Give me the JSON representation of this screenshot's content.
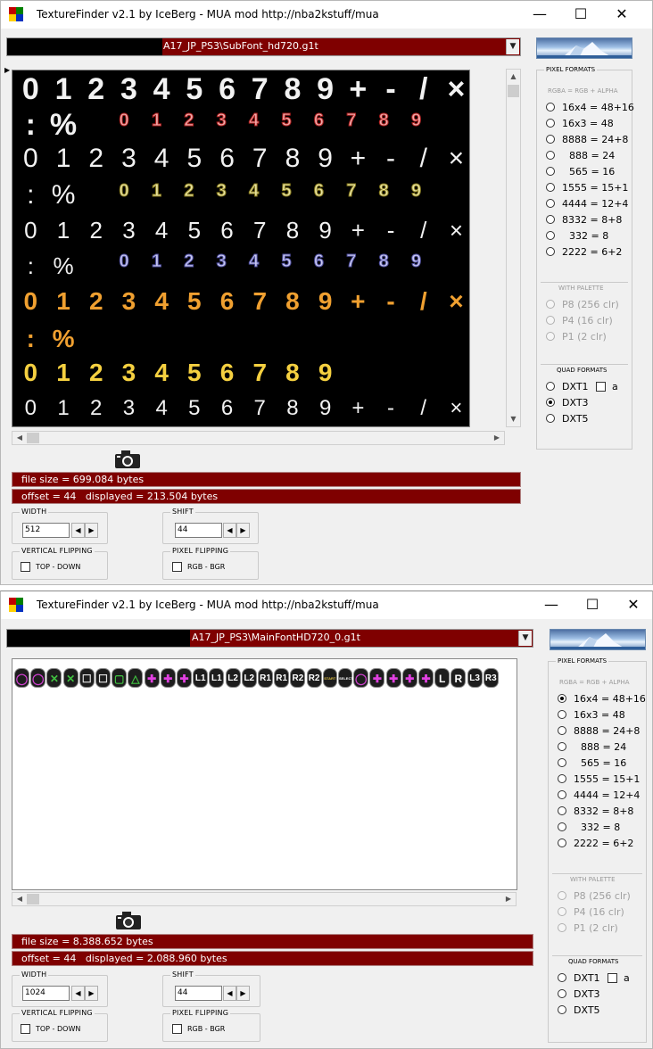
{
  "windows": [
    {
      "title": "TextureFinder v2.1 by IceBerg - MUA mod http://nba2kstuff/mua",
      "controls": {
        "minimize": "—",
        "maximize": "☐",
        "close": "✕"
      },
      "path": "A17_JP_PS3\\SubFont_hd720.g1t",
      "file_size": "file size = 699.084 bytes",
      "offset_info": "offset = 44   displayed = 213.504 bytes",
      "width_label": "WIDTH",
      "width_value": "512",
      "shift_label": "SHIFT",
      "shift_value": "44",
      "vflip_label": "VERTICAL FLIPPING",
      "vflip_option": "TOP - DOWN",
      "pflip_label": "PIXEL FLIPPING",
      "pflip_option": "RGB  -  BGR",
      "pixel_formats_label": "PIXEL FORMATS",
      "rgba_label": "RGBA = RGB + ALPHA",
      "formats": [
        "16x4 = 48+16",
        "16x3 = 48",
        "8888 = 24+8",
        "888 = 24",
        "565 = 16",
        "1555 = 15+1",
        "4444 = 12+4",
        "8332 = 8+8",
        "332 = 8",
        "2222 = 6+2"
      ],
      "selected_format": -1,
      "palette_label": "WITH PALETTE",
      "palette": [
        "P8  (256 clr)",
        "P4  (16 clr)",
        "P1  (2 clr)"
      ],
      "quad_label": "QUAD FORMATS",
      "quad": [
        "DXT1",
        "DXT3",
        "DXT5"
      ],
      "quad_a_label": "a",
      "selected_quad": 1
    },
    {
      "title": "TextureFinder v2.1 by IceBerg - MUA mod http://nba2kstuff/mua",
      "controls": {
        "minimize": "—",
        "maximize": "☐",
        "close": "✕"
      },
      "path": "A17_JP_PS3\\MainFontHD720_0.g1t",
      "file_size": "file size = 8.388.652 bytes",
      "offset_info": "offset = 44   displayed = 2.088.960 bytes",
      "width_label": "WIDTH",
      "width_value": "1024",
      "shift_label": "SHIFT",
      "shift_value": "44",
      "vflip_label": "VERTICAL FLIPPING",
      "vflip_option": "TOP - DOWN",
      "pflip_label": "PIXEL FLIPPING",
      "pflip_option": "RGB  -  BGR",
      "pixel_formats_label": "PIXEL FORMATS",
      "rgba_label": "RGBA = RGB + ALPHA",
      "formats": [
        "16x4 = 48+16",
        "16x3 = 48",
        "8888 = 24+8",
        "888 = 24",
        "565 = 16",
        "1555 = 15+1",
        "4444 = 12+4",
        "8332 = 8+8",
        "332 = 8",
        "2222 = 6+2"
      ],
      "selected_format": 0,
      "palette_label": "WITH PALETTE",
      "palette": [
        "P8  (256 clr)",
        "P4  (16 clr)",
        "P1  (2 clr)"
      ],
      "quad_label": "QUAD FORMATS",
      "quad": [
        "DXT1",
        "DXT3",
        "DXT5"
      ],
      "quad_a_label": "a",
      "selected_quad": -1
    }
  ],
  "texture1": {
    "rows": [
      {
        "glyphs": [
          "0",
          "1",
          "2",
          "3",
          "4",
          "5",
          "6",
          "7",
          "8",
          "9",
          "+",
          "-",
          "/",
          "×"
        ],
        "color": "#f2f2f2",
        "size": 34,
        "bold": true
      },
      {
        "glyphs": [
          ":",
          "%"
        ],
        "color": "#f2f2f2",
        "size": 34,
        "bold": true,
        "small": [
          "0",
          "1",
          "2",
          "3",
          "4",
          "5",
          "6",
          "7",
          "8",
          "9"
        ],
        "small_color": "#f0a8a8",
        "small_stroke": "#b02020"
      },
      {
        "glyphs": [
          "0",
          "1",
          "2",
          "3",
          "4",
          "5",
          "6",
          "7",
          "8",
          "9",
          "+",
          "-",
          "/",
          "×"
        ],
        "color": "#f2f2f2",
        "size": 30,
        "bold": false
      },
      {
        "glyphs": [
          ":",
          "%"
        ],
        "color": "#f2f2f2",
        "size": 30,
        "bold": false,
        "small": [
          "0",
          "1",
          "2",
          "3",
          "4",
          "5",
          "6",
          "7",
          "8",
          "9"
        ],
        "small_color": "#e8e2a0",
        "small_stroke": "#8a7d20"
      },
      {
        "glyphs": [
          "0",
          "1",
          "2",
          "3",
          "4",
          "5",
          "6",
          "7",
          "8",
          "9",
          "+",
          "-",
          "/",
          "×"
        ],
        "color": "#f2f2f2",
        "size": 26,
        "bold": false
      },
      {
        "glyphs": [
          ":",
          "%"
        ],
        "color": "#f2f2f2",
        "size": 26,
        "bold": false,
        "small": [
          "0",
          "1",
          "2",
          "3",
          "4",
          "5",
          "6",
          "7",
          "8",
          "9"
        ],
        "small_color": "#c8c8f0",
        "small_stroke": "#5050a0"
      },
      {
        "glyphs": [
          "0",
          "1",
          "2",
          "3",
          "4",
          "5",
          "6",
          "7",
          "8",
          "9",
          "+",
          "-",
          "/",
          "×"
        ],
        "color": "#f0a030",
        "size": 28,
        "bold": true
      },
      {
        "glyphs": [
          ":",
          "%"
        ],
        "color": "#f0a030",
        "size": 28,
        "bold": true
      },
      {
        "glyphs": [
          "0",
          "1",
          "2",
          "3",
          "4",
          "5",
          "6",
          "7",
          "8",
          "9"
        ],
        "color": "#f5d040",
        "size": 28,
        "bold": true
      },
      {
        "glyphs": [
          "0",
          "1",
          "2",
          "3",
          "4",
          "5",
          "6",
          "7",
          "8",
          "9",
          "+",
          "-",
          "/",
          "×"
        ],
        "color": "#f2f2f2",
        "size": 24,
        "bold": false
      }
    ]
  },
  "texture2": {
    "symbols": [
      "◯",
      "◯",
      "✕",
      "✕",
      "☐",
      "☐",
      "▢",
      "△",
      "✚",
      "✚",
      "✚",
      "L1",
      "L1",
      "L2",
      "L2",
      "R1",
      "R1",
      "R2",
      "R2",
      "START",
      "SELECT",
      "◯",
      "✚",
      "✚",
      "✚",
      "✚",
      "L",
      "R",
      "L3",
      "R3"
    ],
    "symbol_colors": [
      "#d040d0",
      "#d040d0",
      "#40c040",
      "#40c040",
      "#e0e0e0",
      "#e0e0e0",
      "#40c040",
      "#40c040",
      "#e040e0",
      "#e040e0",
      "#e040e0",
      "#ffffff",
      "#ffffff",
      "#ffffff",
      "#ffffff",
      "#ffffff",
      "#ffffff",
      "#ffffff",
      "#ffffff",
      "#e0c040",
      "#ffffff",
      "#d040d0",
      "#e040e0",
      "#e040e0",
      "#e040e0",
      "#e040e0",
      "#ffffff",
      "#ffffff",
      "#ffffff",
      "#ffffff"
    ]
  }
}
